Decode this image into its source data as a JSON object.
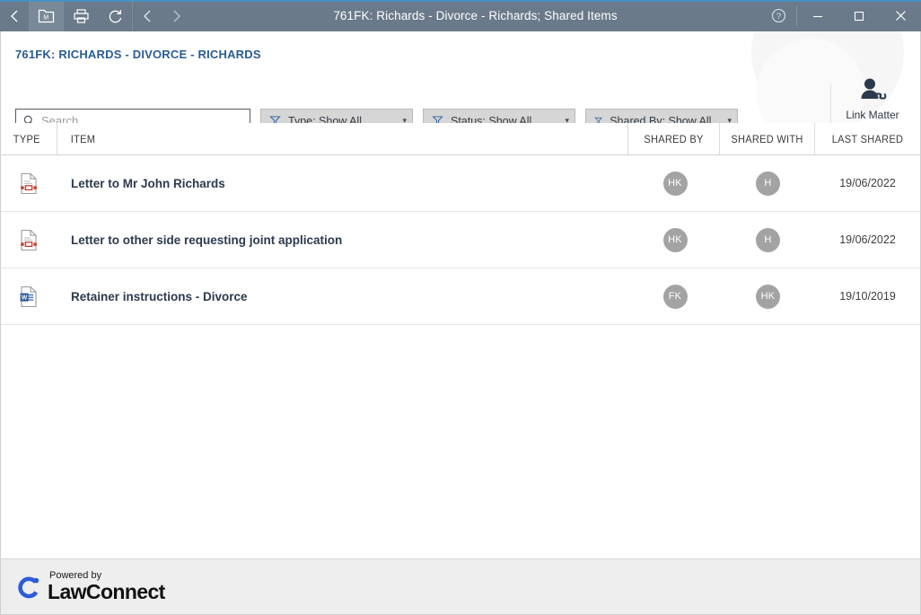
{
  "titlebar": {
    "title": "761FK: Richards - Divorce - Richards; Shared Items",
    "nav_back_icon": "chevron-left-icon",
    "matter_tile_icon": "matter-folder-icon",
    "matter_tile_letter": "M",
    "print_icon": "printer-icon",
    "refresh_icon": "refresh-icon",
    "prev_icon": "chevron-left-icon",
    "next_icon": "chevron-right-icon",
    "help_icon": "help-circle-icon",
    "minimize_icon": "minimize-icon",
    "maximize_icon": "maximize-icon",
    "close_icon": "close-icon",
    "bg_color": "#6a7a8a",
    "accent_color": "#4a90c4"
  },
  "header": {
    "matter_title": "761FK: RICHARDS - DIVORCE - RICHARDS",
    "matter_title_color": "#2a5c92",
    "search": {
      "placeholder": "Search",
      "value": "",
      "icon": "search-icon"
    },
    "filters": [
      {
        "label": "Type: Show All",
        "icon": "filter-funnel-icon",
        "caret": "▾"
      },
      {
        "label": "Status: Show All",
        "icon": "filter-funnel-icon",
        "caret": "▾"
      },
      {
        "label": "Shared By: Show All",
        "icon": "filter-funnel-icon",
        "caret": "▾"
      }
    ],
    "link_matter": {
      "label": "Link Matter",
      "icon": "person-link-icon"
    }
  },
  "table": {
    "columns": [
      {
        "key": "type",
        "label": "TYPE"
      },
      {
        "key": "item",
        "label": "ITEM"
      },
      {
        "key": "shared_by",
        "label": "SHARED BY"
      },
      {
        "key": "shared_with",
        "label": "SHARED WITH"
      },
      {
        "key": "last_shared",
        "label": "LAST SHARED"
      }
    ],
    "rows": [
      {
        "type_icon": "pdf-document-icon",
        "item": "Letter to Mr John Richards",
        "shared_by": "HK",
        "shared_with": "H",
        "last_shared": "19/06/2022"
      },
      {
        "type_icon": "pdf-document-icon",
        "item": "Letter to other side requesting joint application",
        "shared_by": "HK",
        "shared_with": "H",
        "last_shared": "19/06/2022"
      },
      {
        "type_icon": "word-document-icon",
        "item": "Retainer instructions - Divorce",
        "shared_by": "FK",
        "shared_with": "HK",
        "last_shared": "19/10/2019"
      }
    ],
    "avatar_color": "#a3a3a3"
  },
  "footer": {
    "powered_by": "Powered by",
    "brand": "LawConnect",
    "logo_icon": "lawconnect-c-icon",
    "logo_color": "#2d5bd7",
    "bg_color": "#eeeeee"
  }
}
